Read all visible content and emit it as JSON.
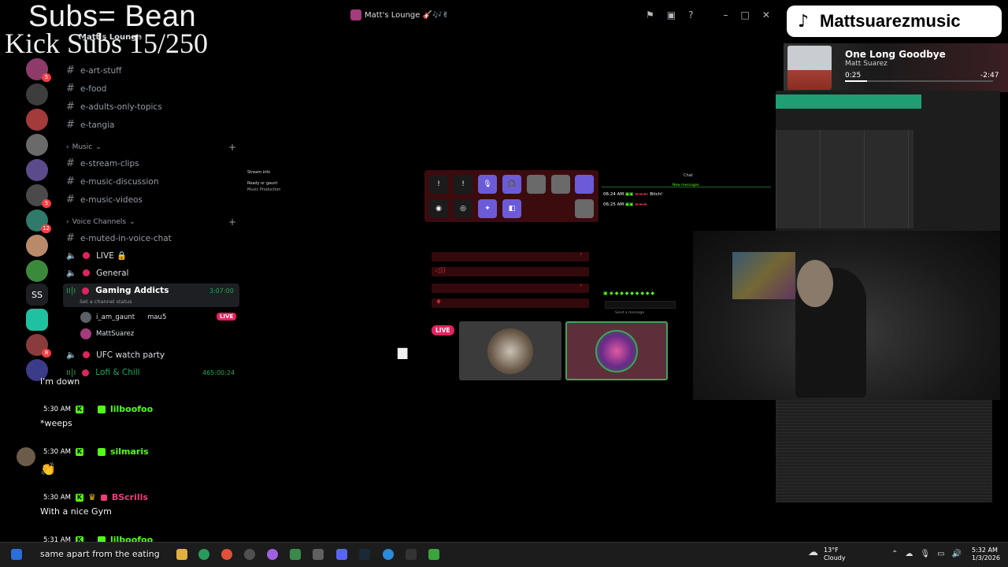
{
  "overlay": {
    "subs_line": "Subs= Bean",
    "kick_line": "Kick Subs 15/250"
  },
  "window": {
    "title": "Matt's Lounge 🎸🎶✌"
  },
  "server": {
    "name": "Matt's Lounge"
  },
  "server_rail": {
    "ss_label": "SS",
    "badges": [
      "5",
      "12",
      "8"
    ]
  },
  "channels": {
    "text_top": [
      "e-art-stuff",
      "e-food",
      "e-adults-only-topics",
      "e-tangia"
    ],
    "music_category": "Music",
    "music": [
      "e-stream-clips",
      "e-music-discussion",
      "e-music-videos"
    ],
    "voice_category": "Voice Channels",
    "voice_text": "e-muted-in-voice-chat",
    "voice": [
      {
        "label": "LIVE 🔒"
      },
      {
        "label": "General"
      },
      {
        "label": "Gaming Addicts",
        "timer": "3:07:00",
        "status": "Set a channel status"
      },
      {
        "label": "UFC watch party"
      },
      {
        "label": "Lofi & Chill",
        "timer": "465:00:24"
      }
    ],
    "members": [
      {
        "name": "i_am_gaunt",
        "extra": "mau5",
        "live": "LIVE"
      },
      {
        "name": "MattSuarez"
      }
    ]
  },
  "stream": {
    "stream_info": "Stream info",
    "stream_sub": "Ready or gaunt",
    "stream_cat": "Music Production",
    "chat_label": "Chat",
    "new_messages": "New messages",
    "chat_lines": [
      {
        "time": "06:24 AM",
        "text": ": Bitch!"
      },
      {
        "time": "06:25 AM",
        "text": ""
      }
    ],
    "send_placeholder": "Send a message",
    "live_label": "LIVE"
  },
  "chat": [
    {
      "text_above": "I'm down"
    },
    {
      "time": "5:30 AM",
      "user": "lilboofoo",
      "color": "#53fc18",
      "text": "*weeps"
    },
    {
      "time": "5:30 AM",
      "user": "silmaris",
      "color": "#53fc18",
      "text": "👏"
    },
    {
      "time": "5:30 AM",
      "user": "BScrills",
      "color": "#f03c7a",
      "text": "With a nice Gym"
    },
    {
      "time": "5:31 AM",
      "user": "lilboofoo",
      "color": "#53fc18",
      "text": "same apart from the eating"
    }
  ],
  "tiktok": {
    "handle": "Mattsuarezmusic"
  },
  "now_playing": {
    "title": "One Long Goodbye",
    "artist": "Matt Suarez",
    "position": "0:25",
    "remaining": "-2:47",
    "progress": 0.15
  },
  "taskbar": {
    "temp": "13°F",
    "weather": "Cloudy",
    "time": "5:32 AM",
    "date": "1/3/2026"
  },
  "colors": {
    "discord_bg": "#000000",
    "kick_green": "#53fc18",
    "live_red": "#e0245e",
    "accent_purple": "#6c5bd9"
  }
}
